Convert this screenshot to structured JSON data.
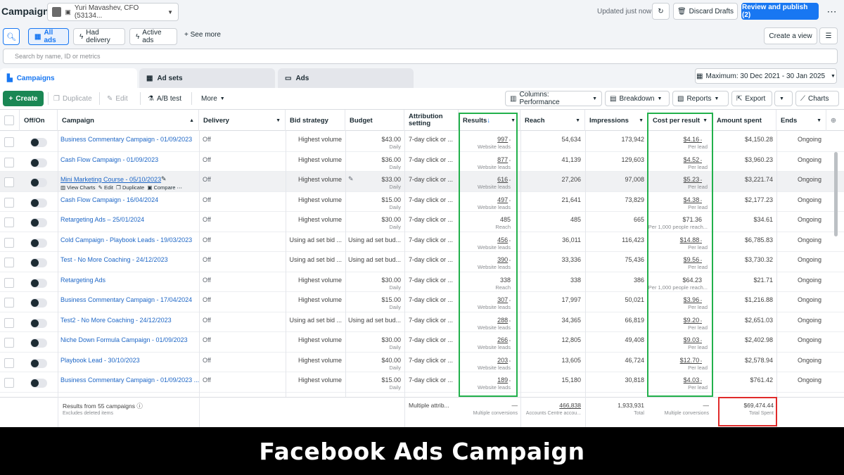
{
  "header": {
    "title": "Campaigns",
    "account": "Yuri Mavashev, CFO (53134...",
    "updated": "Updated just now",
    "discard": "Discard Drafts",
    "publish": "Review and publish (2)"
  },
  "filters": {
    "all_ads": "All ads",
    "had_delivery": "Had delivery",
    "active_ads": "Active ads",
    "see_more": "See more",
    "create_view": "Create a view",
    "search_placeholder": "Search by name, ID or metrics"
  },
  "tabs": [
    {
      "label": "Campaigns"
    },
    {
      "label": "Ad sets"
    },
    {
      "label": "Ads"
    }
  ],
  "date_range": "Maximum: 30 Dec 2021 - 30 Jan 2025",
  "toolbar": {
    "create": "Create",
    "duplicate": "Duplicate",
    "edit": "Edit",
    "ab_test": "A/B test",
    "more": "More",
    "columns": "Columns: Performance",
    "breakdown": "Breakdown",
    "reports": "Reports",
    "export": "Export",
    "charts": "Charts"
  },
  "columns": {
    "off_on": "Off/On",
    "campaign": "Campaign",
    "delivery": "Delivery",
    "bid_strategy": "Bid strategy",
    "budget": "Budget",
    "attribution": "Attribution setting",
    "results": "Results",
    "reach": "Reach",
    "impressions": "Impressions",
    "cost_per_result": "Cost per result",
    "amount_spent": "Amount spent",
    "ends": "Ends"
  },
  "row_actions": {
    "view_charts": "View Charts",
    "edit": "Edit",
    "duplicate": "Duplicate",
    "compare": "Compare"
  },
  "rows": [
    {
      "campaign": "Business Commentary Campaign - 01/09/2023",
      "delivery": "Off",
      "bid": "Highest volume",
      "budget": "$43.00",
      "budget_sub": "Daily",
      "attribution": "7-day click or ...",
      "results": "997",
      "results_sub": "Website leads",
      "reach": "54,634",
      "impressions": "173,942",
      "cpr": "$4.16",
      "cpr_sub": "Per lead",
      "spent": "$4,150.28",
      "ends": "Ongoing"
    },
    {
      "campaign": "Cash Flow Campaign - 01/09/2023",
      "delivery": "Off",
      "bid": "Highest volume",
      "budget": "$36.00",
      "budget_sub": "Daily",
      "attribution": "7-day click or ...",
      "results": "877",
      "results_sub": "Website leads",
      "reach": "41,139",
      "impressions": "129,603",
      "cpr": "$4.52",
      "cpr_sub": "Per lead",
      "spent": "$3,960.23",
      "ends": "Ongoing"
    },
    {
      "campaign": "Mini Marketing Course - 05/10/2023",
      "delivery": "Off",
      "bid": "Highest volume",
      "budget": "$33.00",
      "budget_sub": "Daily",
      "attribution": "7-day click or ...",
      "results": "616",
      "results_sub": "Website leads",
      "reach": "27,206",
      "impressions": "97,008",
      "cpr": "$5.23",
      "cpr_sub": "Per lead",
      "spent": "$3,221.74",
      "ends": "Ongoing"
    },
    {
      "campaign": "Cash Flow Campaign - 16/04/2024",
      "delivery": "Off",
      "bid": "Highest volume",
      "budget": "$15.00",
      "budget_sub": "Daily",
      "attribution": "7-day click or ...",
      "results": "497",
      "results_sub": "Website leads",
      "reach": "21,641",
      "impressions": "73,829",
      "cpr": "$4.38",
      "cpr_sub": "Per lead",
      "spent": "$2,177.23",
      "ends": "Ongoing"
    },
    {
      "campaign": "Retargeting Ads – 25/01/2024",
      "delivery": "Off",
      "bid": "Highest volume",
      "budget": "$30.00",
      "budget_sub": "Daily",
      "attribution": "7-day click or ...",
      "results": "485",
      "results_sub": "Reach",
      "reach": "485",
      "impressions": "665",
      "cpr": "$71.36",
      "cpr_sub": "Per 1,000 people reach...",
      "spent": "$34.61",
      "ends": "Ongoing"
    },
    {
      "campaign": "Cold Campaign - Playbook Leads - 19/03/2023",
      "delivery": "Off",
      "bid": "Using ad set bid ...",
      "budget": "Using ad set bud...",
      "budget_sub": "",
      "attribution": "7-day click or ...",
      "results": "456",
      "results_sub": "Website leads",
      "reach": "36,011",
      "impressions": "116,423",
      "cpr": "$14.88",
      "cpr_sub": "Per lead",
      "spent": "$6,785.83",
      "ends": "Ongoing"
    },
    {
      "campaign": "Test - No More Coaching - 24/12/2023",
      "delivery": "Off",
      "bid": "Using ad set bid ...",
      "budget": "Using ad set bud...",
      "budget_sub": "",
      "attribution": "7-day click or ...",
      "results": "390",
      "results_sub": "Website leads",
      "reach": "33,336",
      "impressions": "75,436",
      "cpr": "$9.56",
      "cpr_sub": "Per lead",
      "spent": "$3,730.32",
      "ends": "Ongoing"
    },
    {
      "campaign": "Retargeting Ads",
      "delivery": "Off",
      "bid": "Highest volume",
      "budget": "$30.00",
      "budget_sub": "Daily",
      "attribution": "7-day click or ...",
      "results": "338",
      "results_sub": "Reach",
      "reach": "338",
      "impressions": "386",
      "cpr": "$64.23",
      "cpr_sub": "Per 1,000 people reach...",
      "spent": "$21.71",
      "ends": "Ongoing"
    },
    {
      "campaign": "Business Commentary Campaign - 17/04/2024",
      "delivery": "Off",
      "bid": "Highest volume",
      "budget": "$15.00",
      "budget_sub": "Daily",
      "attribution": "7-day click or ...",
      "results": "307",
      "results_sub": "Website leads",
      "reach": "17,997",
      "impressions": "50,021",
      "cpr": "$3.96",
      "cpr_sub": "Per lead",
      "spent": "$1,216.88",
      "ends": "Ongoing"
    },
    {
      "campaign": "Test2 - No More Coaching - 24/12/2023",
      "delivery": "Off",
      "bid": "Using ad set bid ...",
      "budget": "Using ad set bud...",
      "budget_sub": "",
      "attribution": "7-day click or ...",
      "results": "288",
      "results_sub": "Website leads",
      "reach": "34,365",
      "impressions": "66,819",
      "cpr": "$9.20",
      "cpr_sub": "Per lead",
      "spent": "$2,651.03",
      "ends": "Ongoing"
    },
    {
      "campaign": "Niche Down Formula Campaign - 01/09/2023",
      "delivery": "Off",
      "bid": "Highest volume",
      "budget": "$30.00",
      "budget_sub": "Daily",
      "attribution": "7-day click or ...",
      "results": "266",
      "results_sub": "Website leads",
      "reach": "12,805",
      "impressions": "49,408",
      "cpr": "$9.03",
      "cpr_sub": "Per lead",
      "spent": "$2,402.98",
      "ends": "Ongoing"
    },
    {
      "campaign": "Playbook Lead - 30/10/2023",
      "delivery": "Off",
      "bid": "Highest volume",
      "budget": "$40.00",
      "budget_sub": "Daily",
      "attribution": "7-day click or ...",
      "results": "203",
      "results_sub": "Website leads",
      "reach": "13,605",
      "impressions": "46,724",
      "cpr": "$12.70",
      "cpr_sub": "Per lead",
      "spent": "$2,578.94",
      "ends": "Ongoing"
    },
    {
      "campaign": "Business Commentary Campaign - 01/09/2023 ...",
      "delivery": "Off",
      "bid": "Highest volume",
      "budget": "$15.00",
      "budget_sub": "Daily",
      "attribution": "7-day click or ...",
      "results": "189",
      "results_sub": "Website leads",
      "reach": "15,180",
      "impressions": "30,818",
      "cpr": "$4.03",
      "cpr_sub": "Per lead",
      "spent": "$761.42",
      "ends": "Ongoing"
    }
  ],
  "totals": {
    "label": "Results from 55 campaigns",
    "label_sub": "Excludes deleted items",
    "attribution": "Multiple attrib...",
    "results": "—",
    "results_sub": "Multiple conversions",
    "reach": "466,838",
    "reach_sub": "Accounts Centre accou...",
    "impressions": "1,933,931",
    "impressions_sub": "Total",
    "cpr": "—",
    "cpr_sub": "Multiple conversions",
    "spent": "$69,474.44",
    "spent_sub": "Total Spent"
  },
  "caption": "Facebook Ads Campaign",
  "colors": {
    "primary": "#1877f2",
    "create": "#1a8754",
    "highlight_green": "#22b14c",
    "highlight_red": "#e02b2b",
    "link": "#1d66c6"
  }
}
